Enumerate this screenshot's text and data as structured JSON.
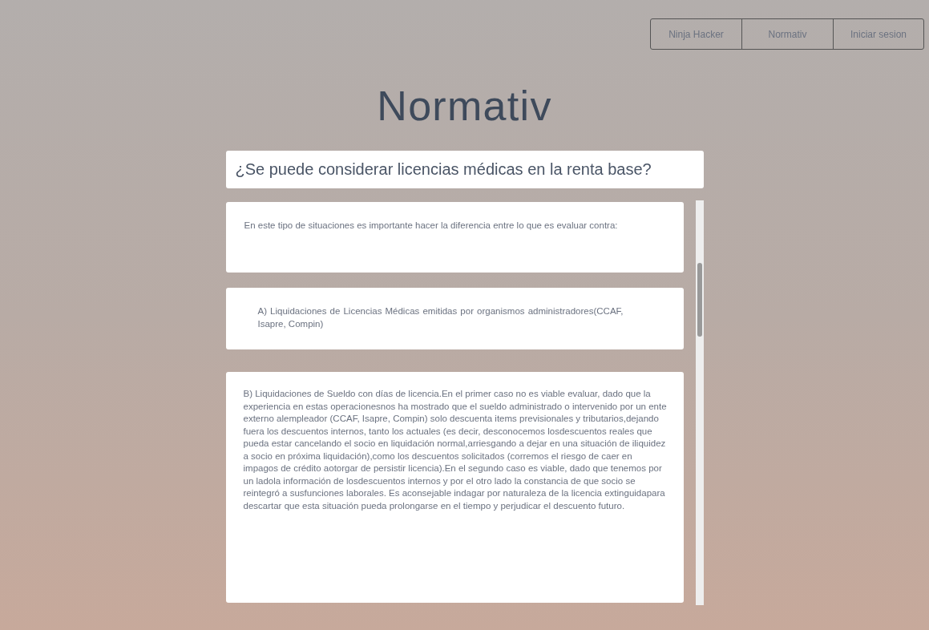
{
  "nav_links": [
    "Ninja Hacker",
    "Normativ",
    "Iniciar sesion"
  ],
  "title": "Normativ",
  "question": {
    "value": "¿Se puede considerar licencias médicas en la renta base?"
  },
  "answers": [
    {
      "text": "En este tipo de situaciones es importante hacer la diferencia entre lo que es evaluar contra:"
    },
    {
      "text": "A) Liquidaciones de Licencias Médicas emitidas por organismos administradores(CCAF, Isapre, Compin)"
    },
    {
      "text": "B) Liquidaciones de Sueldo con días de licencia.En el primer caso no es viable evaluar, dado que la experiencia en estas operacionesnos ha mostrado que el sueldo administrado o intervenido por un ente externo alempleador (CCAF, Isapre, Compin) solo descuenta items previsionales y tributarios,dejando fuera los descuentos internos, tanto los actuales (es decir, desconocemos losdescuentos reales que pueda estar cancelando el socio en liquidación normal,arriesgando a dejar en una situación de iliquidez a socio en próxima liquidación),como los descuentos solicitados (corremos el riesgo de caer en impagos de crédito aotorgar de persistir licencia).En el segundo caso es viable, dado que tenemos por un ladola información de losdescuentos internos y por el otro lado la constancia de que socio se reintegró a susfunciones laborales. Es aconsejable indagar por naturaleza de la licencia extinguidapara descartar que esta situación pueda prolongarse en el tiempo y perjudicar el descuento futuro."
    }
  ]
}
